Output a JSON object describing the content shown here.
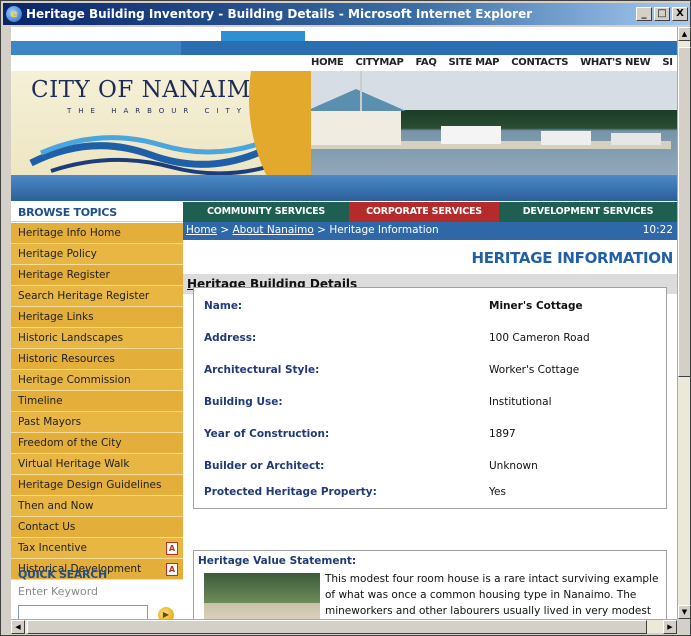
{
  "window": {
    "title": "Heritage Building Inventory - Building Details - Microsoft Internet Explorer",
    "minimize": "_",
    "maximize": "□",
    "close": "X"
  },
  "topnav": [
    "HOME",
    "CITYMAP",
    "FAQ",
    "SITE MAP",
    "CONTACTS",
    "WHAT'S NEW",
    "SI"
  ],
  "logo": {
    "city": "CITY OF NANAIMO",
    "subtitle": "THE HARBOUR CITY"
  },
  "sections": {
    "community": "COMMUNITY SERVICES",
    "corporate": "CORPORATE SERVICES",
    "development": "DEVELOPMENT SERVICES"
  },
  "sidebar": {
    "title": "BROWSE TOPICS",
    "items": [
      {
        "label": "Heritage Info Home"
      },
      {
        "label": "Heritage Policy"
      },
      {
        "label": "Heritage Register"
      },
      {
        "label": "Search Heritage Register"
      },
      {
        "label": "Heritage Links"
      },
      {
        "label": "Historic Landscapes"
      },
      {
        "label": "Historic Resources"
      },
      {
        "label": "Heritage Commission"
      },
      {
        "label": "Timeline"
      },
      {
        "label": "Past Mayors"
      },
      {
        "label": "Freedom of the City"
      },
      {
        "label": "Virtual Heritage Walk"
      },
      {
        "label": "Heritage Design Guidelines"
      },
      {
        "label": "Then and Now"
      },
      {
        "label": "Contact Us"
      },
      {
        "label": "Tax Incentive",
        "icon": "pdf-icon"
      },
      {
        "label": "Historical Development",
        "icon": "pdf-icon"
      }
    ],
    "quick_search_title": "QUICK SEARCH",
    "keyword_label": "Enter Keyword",
    "keyword_value": ""
  },
  "breadcrumb": {
    "home": "Home",
    "sep1": " > ",
    "about": "About Nanaimo",
    "sep2": " > ",
    "current": "Heritage Information",
    "time": "10:22"
  },
  "page_heading": "HERITAGE INFORMATION",
  "details_title": "Heritage Building Details",
  "details": [
    {
      "label": "Name:",
      "value": "Miner's Cottage",
      "bold": true
    },
    {
      "label": "Address:",
      "value": "100 Cameron Road"
    },
    {
      "label": "Architectural Style:",
      "value": "Worker's Cottage"
    },
    {
      "label": "Building Use:",
      "value": "Institutional"
    },
    {
      "label": "Year of Construction:",
      "value": "1897"
    },
    {
      "label": "Builder or Architect:",
      "value": "Unknown"
    },
    {
      "label": "Protected Heritage Property:",
      "value": "Yes"
    }
  ],
  "heritage_value": {
    "title": "Heritage Value Statement:",
    "text": "This modest four room house is a rare intact surviving example of what was once a common housing type in Nanaimo. The mineworkers and other labourers usually lived in very modest"
  }
}
